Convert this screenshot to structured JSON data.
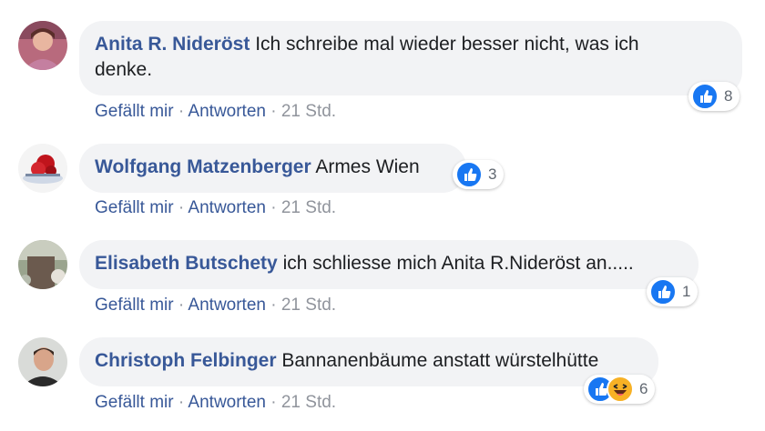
{
  "colors": {
    "author": "#385898",
    "like_blue": "#1877f2",
    "haha_yellow": "#f7b125",
    "bubble_bg": "#f2f3f5",
    "meta_grey": "#90949c"
  },
  "comments": [
    {
      "author": "Anita R. Nideröst",
      "text_line1": "Ich schreibe mal wieder besser nicht, was ich",
      "text_line2": "denke.",
      "reactions": [
        "like-icon"
      ],
      "reaction_count": "8",
      "like_label": "Gefällt mir",
      "reply_label": "Antworten",
      "time": "21 Std."
    },
    {
      "author": "Wolfgang Matzenberger",
      "text": "Armes Wien",
      "reactions": [
        "like-icon"
      ],
      "reaction_count": "3",
      "like_label": "Gefällt mir",
      "reply_label": "Antworten",
      "time": "21 Std."
    },
    {
      "author": "Elisabeth Butschety",
      "text": "ich schliesse mich Anita R.Nideröst an.....",
      "reactions": [
        "like-icon"
      ],
      "reaction_count": "1",
      "like_label": "Gefällt mir",
      "reply_label": "Antworten",
      "time": "21 Std."
    },
    {
      "author": "Christoph Felbinger",
      "text": "Bannanenbäume anstatt würstelhütte",
      "reactions": [
        "like-icon",
        "haha-icon"
      ],
      "reaction_count": "6",
      "like_label": "Gefällt mir",
      "reply_label": "Antworten",
      "time": "21 Std."
    }
  ],
  "separator": "·"
}
